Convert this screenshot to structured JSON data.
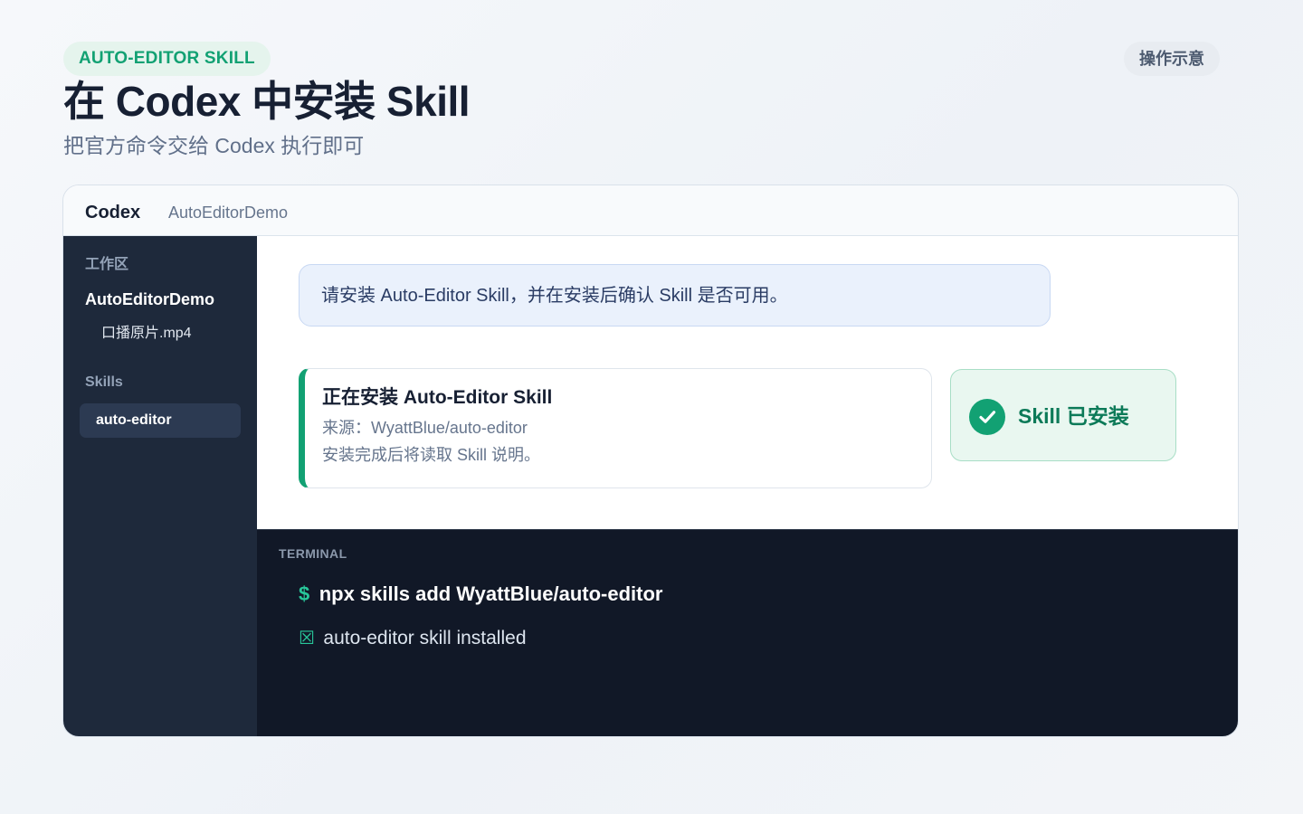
{
  "header": {
    "badge": "AUTO-EDITOR SKILL",
    "title": "在 Codex 中安装 Skill",
    "subtitle": "把官方命令交给 Codex 执行即可",
    "demo_label": "操作示意"
  },
  "window": {
    "app_name": "Codex",
    "project_name": "AutoEditorDemo",
    "sidebar": {
      "workspace_heading": "工作区",
      "workspace_name": "AutoEditorDemo",
      "file": "口播原片.mp4",
      "skills_heading": "Skills",
      "active_skill": "auto-editor"
    },
    "main": {
      "prompt": "请安装 Auto-Editor Skill，并在安装后确认 Skill 是否可用。",
      "install_card": {
        "title": "正在安装 Auto-Editor Skill",
        "source": "来源：WyattBlue/auto-editor",
        "note": "安装完成后将读取 Skill 说明。"
      },
      "status": {
        "icon": "check-circle-icon",
        "text": "Skill 已安装"
      }
    },
    "terminal": {
      "label": "TERMINAL",
      "prompt_symbol": "$",
      "command": "npx skills add WyattBlue/auto-editor",
      "output_icon": "☒",
      "output": "auto-editor skill installed"
    }
  },
  "colors": {
    "accent": "#12A173",
    "sidebar": "#1E293B",
    "terminal": "#111827",
    "prompt_background": "#EAF1FC"
  }
}
